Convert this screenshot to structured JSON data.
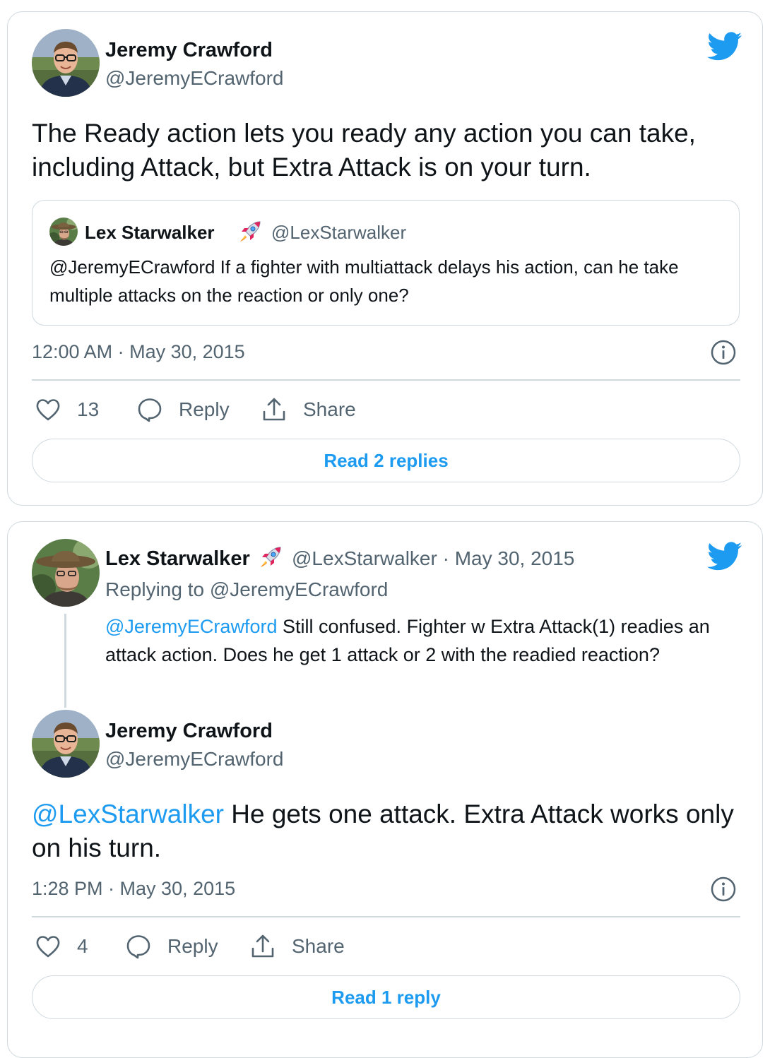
{
  "colors": {
    "accent": "#1d9bf0",
    "text": "#0f1419",
    "muted": "#536471",
    "border": "#cfd9de"
  },
  "tweet1": {
    "author": {
      "name": "Jeremy Crawford",
      "handle": "@JeremyECrawford",
      "avatar": "jeremy-avatar"
    },
    "text": "The Ready action lets you ready any action you can take, including Attack, but Extra Attack is on your turn.",
    "quoted": {
      "name": "Lex Starwalker",
      "emoji": "rocket-icon",
      "handle": "@LexStarwalker",
      "text": "@JeremyECrawford If a fighter with multiattack delays his action, can he take multiple attacks on the reaction or only one?"
    },
    "timestamp": "12:00 AM · May 30, 2015",
    "likes": "13",
    "reply_label": "Reply",
    "share_label": "Share",
    "read_replies": "Read 2 replies"
  },
  "tweet2": {
    "parent": {
      "name": "Lex Starwalker",
      "emoji": "rocket-icon",
      "handle_date": "@LexStarwalker · May 30, 2015",
      "replying_to": "Replying to @JeremyECrawford",
      "mention": "@JeremyECrawford",
      "text": " Still confused. Fighter w Extra Attack(1) readies an attack action. Does he get 1 attack or 2 with the readied reaction?"
    },
    "author": {
      "name": "Jeremy Crawford",
      "handle": "@JeremyECrawford"
    },
    "mention": "@LexStarwalker",
    "text": " He gets one attack. Extra Attack works only on his turn.",
    "timestamp": "1:28 PM · May 30, 2015",
    "likes": "4",
    "reply_label": "Reply",
    "share_label": "Share",
    "read_replies": "Read 1 reply"
  }
}
